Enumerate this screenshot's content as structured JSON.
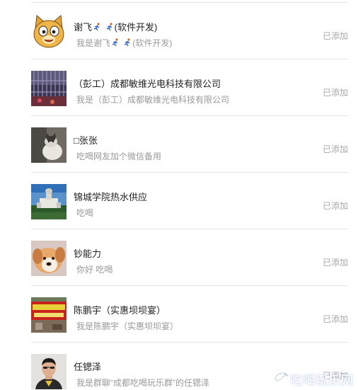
{
  "contacts": [
    {
      "name_a": "谢飞",
      "name_b": "(软件开发)",
      "msg_a": "我是谢飞",
      "msg_b": "(软件开发)",
      "status": "已添加",
      "avatar": "cartoon-cat"
    },
    {
      "name": "（彭工）成都敏维光电科技有限公司",
      "msg": "我是（彭工）成都敏维光电科技有限公司",
      "status": "已添加",
      "avatar": "building-photo"
    },
    {
      "name": "□张张",
      "msg": "吃喝网友加个微信备用",
      "status": "已添加",
      "avatar": "cat-photo"
    },
    {
      "name": "锦城学院热水供应",
      "msg": "吃喝",
      "status": "已添加",
      "avatar": "campus-photo"
    },
    {
      "name": "钞能力",
      "msg": "你好 吃喝",
      "status": "已添加",
      "avatar": "dog-photo"
    },
    {
      "name": "陈鹏宇（实惠坝坝宴）",
      "msg": "我是陈鹏宇（实惠坝坝宴）",
      "status": "已添加",
      "avatar": "banner-photo"
    },
    {
      "name": "任锶泽",
      "msg": "我是群聊“成都吃喝玩乐群”的任锶泽",
      "status": "已添加",
      "avatar": "person-photo"
    }
  ],
  "watermark": {
    "text": "吃喝玩乐网",
    "icon": "bird-logo-icon"
  },
  "colors": {
    "status": "#a8a8a8",
    "secondary": "#9a9a9a",
    "divider": "#e6e6e6"
  }
}
